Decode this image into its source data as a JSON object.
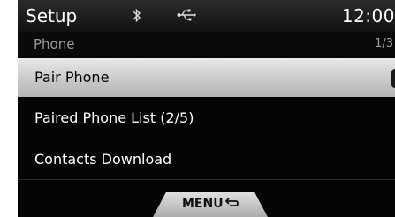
{
  "header": {
    "title": "Setup",
    "time": "12:00",
    "icons": [
      "bluetooth-icon",
      "usb-icon"
    ]
  },
  "subheader": {
    "section": "Phone",
    "page_indicator": "1/3"
  },
  "menu": {
    "items": [
      {
        "label": "Pair Phone",
        "selected": true
      },
      {
        "label": "Paired Phone List (2/5)",
        "selected": false
      },
      {
        "label": "Contacts Download",
        "selected": false
      }
    ]
  },
  "footer": {
    "menu_label": "MENU",
    "icon": "return-icon"
  },
  "colors": {
    "background": "#050505",
    "selected_row": "#cfcfcf",
    "text": "#ffffff",
    "muted_text": "#9a9a9a"
  }
}
